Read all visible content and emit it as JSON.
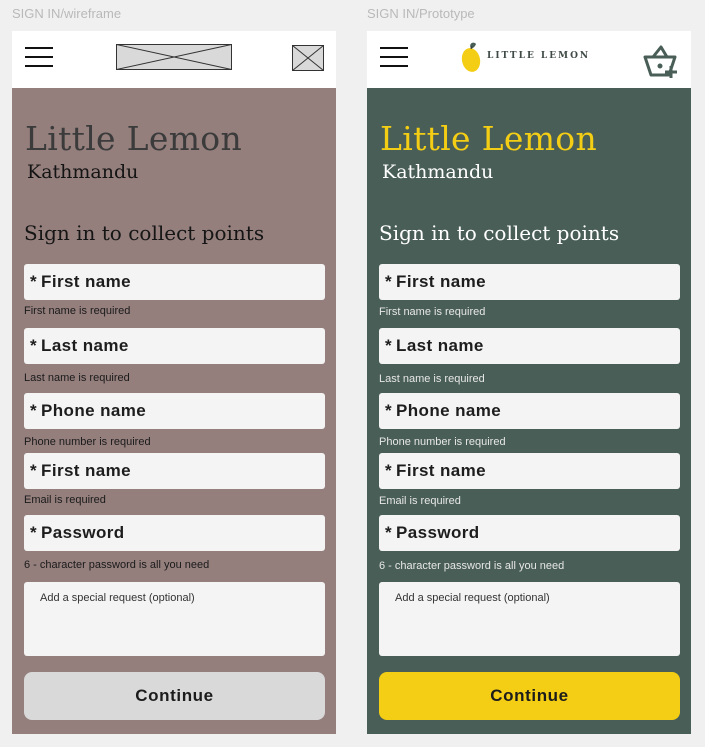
{
  "frames": {
    "wireframe": {
      "label": "SIGN IN/wireframe",
      "title": "Little Lemon",
      "subtitle": "Kathmandu",
      "heading": "Sign in to collect points",
      "fields": [
        {
          "label": "First name",
          "hint": "First name is required"
        },
        {
          "label": "Last name",
          "hint": "Last name is required"
        },
        {
          "label": "Phone name",
          "hint": "Phone number is required"
        },
        {
          "label": "First name",
          "hint": "Email is required"
        },
        {
          "label": "Password",
          "hint": "6 - character password is all you need"
        }
      ],
      "required_marker": "*",
      "textarea_placeholder": "Add a special request (optional)",
      "continue_label": "Continue",
      "bg_color": "#947f7d"
    },
    "prototype": {
      "label": "SIGN IN/Prototype",
      "logo_text": "LITTLE LEMON",
      "title": "Little Lemon",
      "subtitle": "Kathmandu",
      "heading": "Sign in to collect points",
      "fields": [
        {
          "label": "First name",
          "hint": "First name is required"
        },
        {
          "label": "Last name",
          "hint": "Last name is required"
        },
        {
          "label": "Phone name",
          "hint": "Phone number is required"
        },
        {
          "label": "First name",
          "hint": "Email is required"
        },
        {
          "label": "Password",
          "hint": "6 - character password is all you need"
        }
      ],
      "required_marker": "*",
      "textarea_placeholder": "Add a special request (optional)",
      "continue_label": "Continue",
      "bg_color": "#495e57",
      "accent_color": "#f4ce14"
    }
  },
  "icons": [
    "menu-icon",
    "logo-placeholder",
    "cart-placeholder",
    "lemon-logo-icon",
    "cart-add-icon"
  ]
}
